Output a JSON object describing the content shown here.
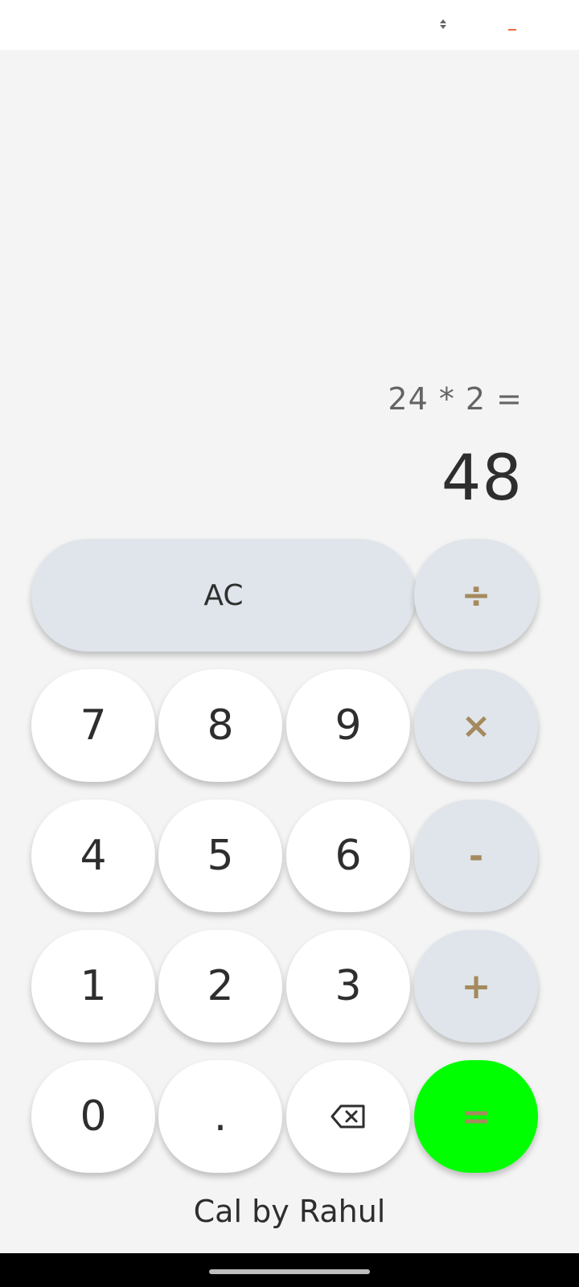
{
  "display": {
    "expression": "24 * 2 =",
    "result": "48"
  },
  "keypad": {
    "row1": {
      "clear": "AC",
      "divide": "÷"
    },
    "row2": {
      "seven": "7",
      "eight": "8",
      "nine": "9",
      "multiply": "×"
    },
    "row3": {
      "four": "4",
      "five": "5",
      "six": "6",
      "minus": "-"
    },
    "row4": {
      "one": "1",
      "two": "2",
      "three": "3",
      "plus": "+"
    },
    "row5": {
      "zero": "0",
      "decimal": ".",
      "backspace_icon": "backspace-icon",
      "equals": "="
    }
  },
  "footer": {
    "label": "Cal by Rahul"
  },
  "colors": {
    "background": "#f4f4f4",
    "number_button": "#ffffff",
    "operator_button": "#dfe5ea",
    "operator_text": "#a58a5f",
    "equals_button": "#00ff00",
    "minimize_accent": "#ef6c3a"
  }
}
